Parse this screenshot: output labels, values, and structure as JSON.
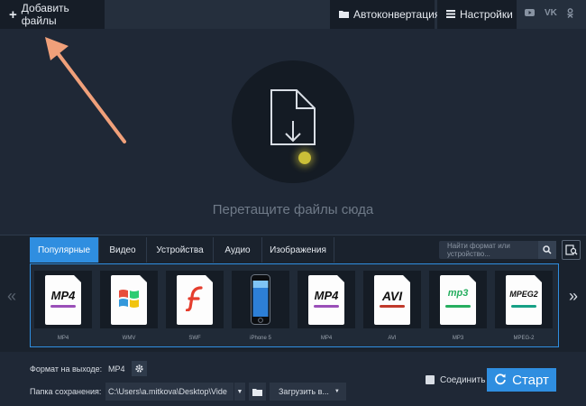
{
  "topbar": {
    "add_files": "Добавить файлы",
    "autoconvert": "Автоконвертация",
    "settings": "Настройки",
    "social": [
      "youtube-icon",
      "vk-icon",
      "odnoklassniki-icon"
    ]
  },
  "dropzone": {
    "hint": "Перетащите файлы сюда"
  },
  "tabs": [
    {
      "label": "Популярные",
      "active": true
    },
    {
      "label": "Видео"
    },
    {
      "label": "Устройства"
    },
    {
      "label": "Аудио"
    },
    {
      "label": "Изображения"
    }
  ],
  "search": {
    "placeholder": "Найти формат или устройство..."
  },
  "formats": [
    {
      "badge": "MP4",
      "label": "MP4",
      "bar": "#9a4fb8"
    },
    {
      "badge": "",
      "label": "WMV",
      "icon": "windows-logo-icon"
    },
    {
      "badge": "",
      "label": "SWF",
      "icon": "flash-logo-icon"
    },
    {
      "badge": "",
      "label": "iPhone 5",
      "icon": "iphone-icon"
    },
    {
      "badge": "MP4",
      "label": "MP4",
      "bar": "#9a4fb8"
    },
    {
      "badge": "AVI",
      "label": "AVI",
      "bar": "#c0392b"
    },
    {
      "badge": "mp3",
      "label": "MP3",
      "bar": "#27ae60"
    },
    {
      "badge": "MPEG2",
      "label": "MPEG-2",
      "bar": "#16a085"
    }
  ],
  "bottom": {
    "output_label": "Формат на выходе:",
    "output_value": "MP4",
    "folder_label": "Папка сохранения:",
    "folder_path": "C:\\Users\\a.mitkova\\Desktop\\Vide",
    "upload": "Загрузить в...",
    "join": "Соединить",
    "start": "Старт"
  },
  "colors": {
    "accent": "#2f8ee0",
    "annotation_arrow": "#f0a07a"
  }
}
